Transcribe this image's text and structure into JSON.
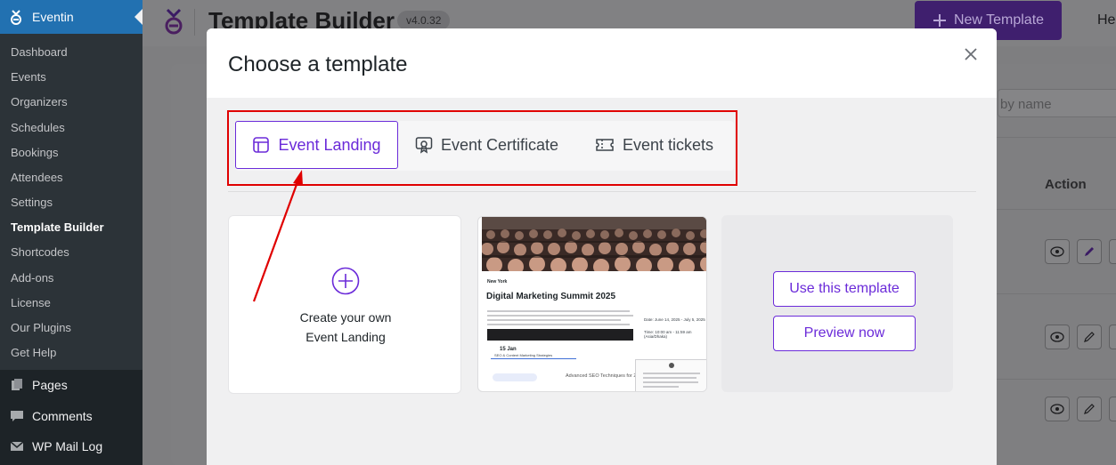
{
  "brand": {
    "app_name": "Eventin",
    "accent": "#6b2bd9",
    "wp_blue": "#2271b1"
  },
  "sidebar": {
    "submenu": [
      {
        "label": "Dashboard"
      },
      {
        "label": "Events"
      },
      {
        "label": "Organizers"
      },
      {
        "label": "Schedules"
      },
      {
        "label": "Bookings"
      },
      {
        "label": "Attendees"
      },
      {
        "label": "Settings"
      },
      {
        "label": "Template Builder",
        "current": true
      },
      {
        "label": "Shortcodes"
      },
      {
        "label": "Add-ons"
      },
      {
        "label": "License"
      },
      {
        "label": "Our Plugins"
      },
      {
        "label": "Get Help"
      }
    ],
    "menu": [
      {
        "label": "Pages",
        "icon": "pages-icon"
      },
      {
        "label": "Comments",
        "icon": "comments-icon"
      },
      {
        "label": "WP Mail Log",
        "icon": "mail-icon"
      }
    ]
  },
  "page": {
    "title": "Template Builder",
    "version": "v4.0.32",
    "new_template_label": "New Template",
    "help_label": "He",
    "search_placeholder": "by name",
    "action_header": "Action"
  },
  "modal": {
    "title": "Choose a template",
    "tabs": [
      {
        "label": "Event Landing",
        "icon": "layout-icon",
        "active": true
      },
      {
        "label": "Event Certificate",
        "icon": "certificate-icon",
        "active": false
      },
      {
        "label": "Event tickets",
        "icon": "ticket-icon",
        "active": false
      }
    ],
    "create_card": {
      "line1": "Create your own",
      "line2": "Event Landing"
    },
    "preview": {
      "city": "New York",
      "title": "Digital Marketing Summit 2025",
      "date_label": "Date: June 14, 2025 - July 5, 2025",
      "time_label": "Time: 10:00 am - 11:59 am (Asia/Dhaka)",
      "day": "15 Jan",
      "day_sub": "SEO & Content Marketing Strategies",
      "session": "Advanced SEO Techniques for 2025"
    },
    "actions": {
      "use_label": "Use this template",
      "preview_label": "Preview now"
    }
  }
}
